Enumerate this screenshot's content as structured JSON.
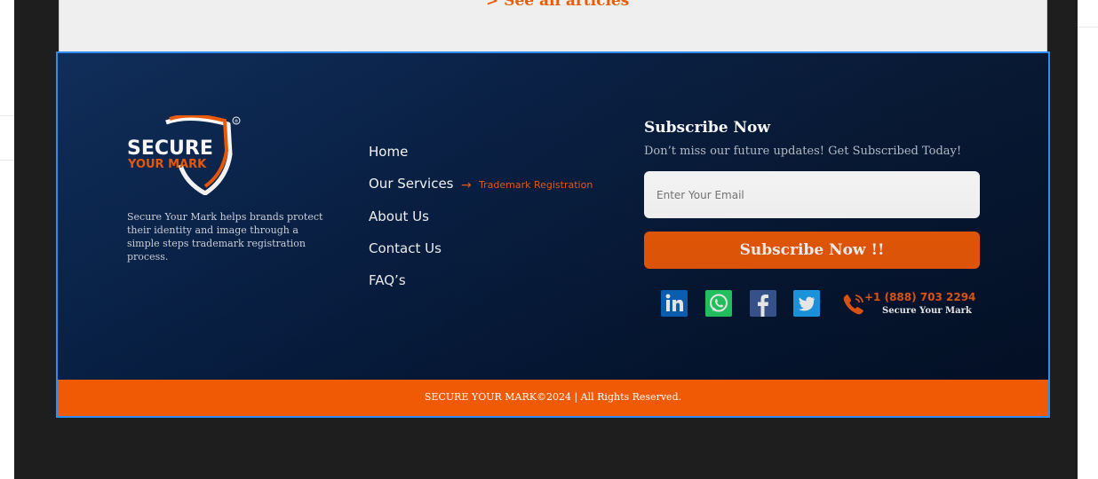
{
  "top_section": {
    "see_all": "> See all articles"
  },
  "footer": {
    "brand": {
      "line1": "SECURE",
      "line2": "YOUR MARK",
      "registered": "®"
    },
    "about": "Secure Your Mark helps brands protect their identity and image through a simple steps trademark registration process.",
    "nav": [
      {
        "label": "Home"
      },
      {
        "label": "Our Services"
      },
      {
        "label": "About Us"
      },
      {
        "label": "Contact Us"
      },
      {
        "label": "FAQ’s"
      }
    ],
    "services_sub": {
      "arrow": "→",
      "label": "Trademark Registration"
    },
    "subscribe": {
      "title": "Subscribe Now",
      "description": "Don’t miss our future updates! Get Subscribed Today!",
      "email_placeholder": "Enter Your Email",
      "button_label": "Subscribe Now !!"
    },
    "social": [
      {
        "icon": "linkedin-icon",
        "color": "#0a66c2"
      },
      {
        "icon": "whatsapp-icon",
        "color": "#25d366"
      },
      {
        "icon": "facebook-icon",
        "color": "#3b5998"
      },
      {
        "icon": "twitter-icon",
        "color": "#1da1f2"
      }
    ],
    "contact": {
      "phone": "+1 (888) 703 2294",
      "label": "Secure Your Mark"
    },
    "copyright": "SECURE YOUR MARK©2024 | All Rights Reserved."
  },
  "colors": {
    "accent": "#f05a05",
    "footer_bg": "#061d42",
    "selection_border": "#2f8cf0"
  }
}
